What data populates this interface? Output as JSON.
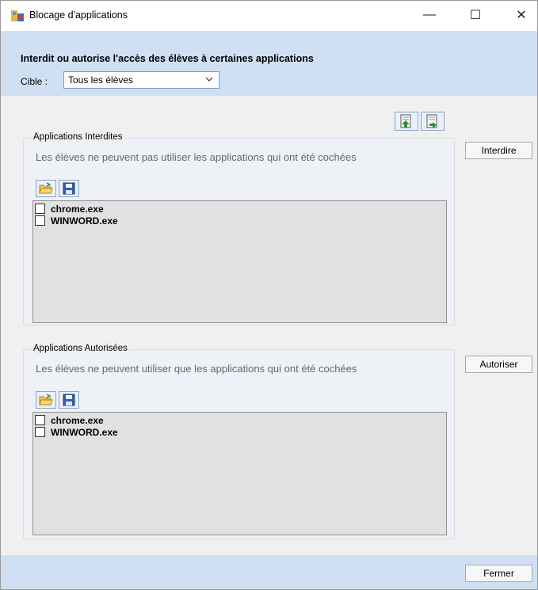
{
  "window": {
    "title": "Blocage d'applications",
    "controls": {
      "minimize": "—",
      "maximize": "☐",
      "close": "✕"
    }
  },
  "header": {
    "title": "Interdit ou autorise l'accès des élèves à certaines applications",
    "cible_label": "Cible :",
    "cible_value": "Tous les élèves"
  },
  "forbidden": {
    "legend": "Applications Interdites",
    "description": "Les élèves ne peuvent pas utiliser les applications qui ont été cochées",
    "items": [
      {
        "label": "chrome.exe",
        "checked": false
      },
      {
        "label": "WINWORD.exe",
        "checked": false
      }
    ],
    "button": "Interdire"
  },
  "allowed": {
    "legend": "Applications Autorisées",
    "description": "Les élèves ne peuvent utiliser que les applications qui ont été cochées",
    "items": [
      {
        "label": "chrome.exe",
        "checked": false
      },
      {
        "label": "WINWORD.exe",
        "checked": false
      }
    ],
    "button": "Autoriser"
  },
  "footer": {
    "close_button": "Fermer"
  },
  "colors": {
    "header_band": "#cfe0f3",
    "panel_bg": "#f0f0f0",
    "list_bg": "#e1e1e1",
    "description_text": "#5a6a7a"
  },
  "icons": {
    "app": "app-shield-icon",
    "import": "import-list-icon",
    "export": "export-list-icon",
    "open": "open-folder-icon",
    "save": "save-disk-icon"
  }
}
